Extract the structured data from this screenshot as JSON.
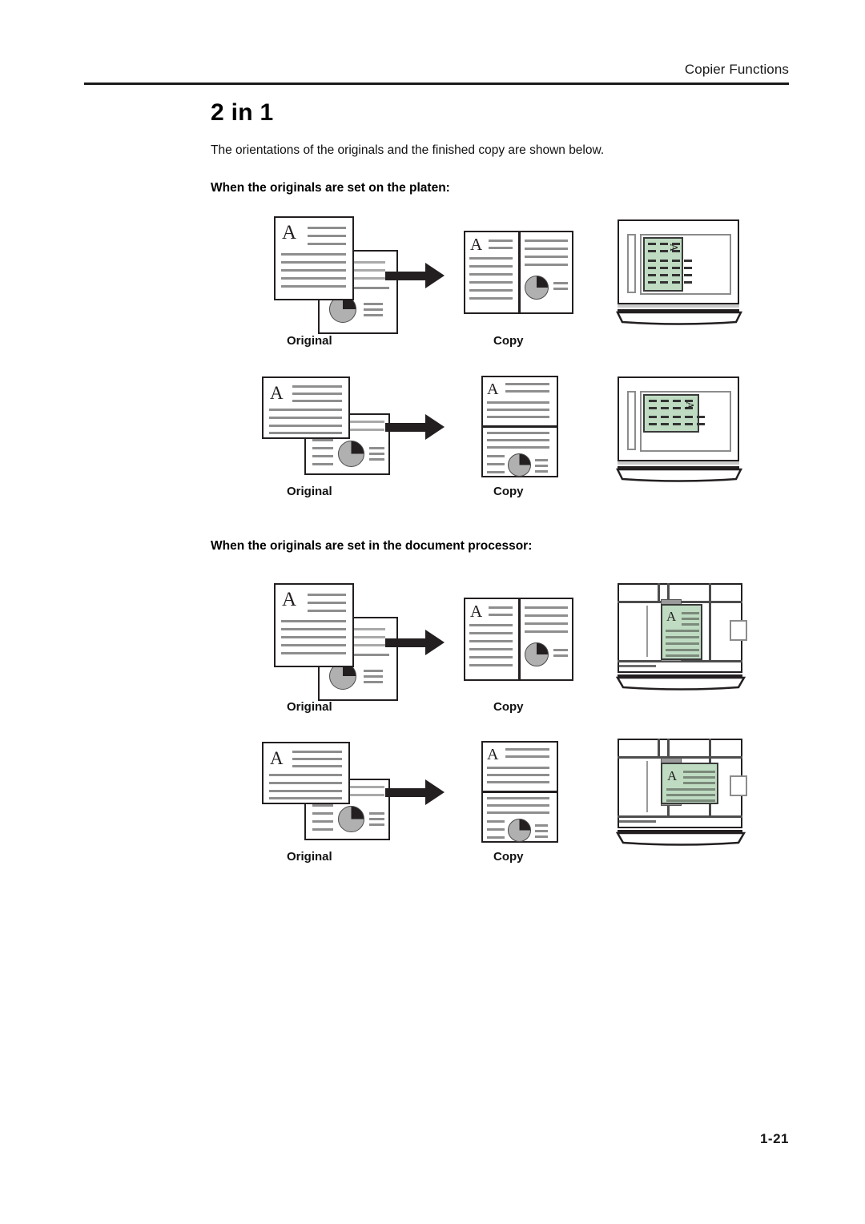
{
  "header": {
    "running_head": "Copier Functions"
  },
  "content": {
    "title": "2 in 1",
    "intro": "The orientations of the originals and the finished copy are shown below.",
    "subhead_platen": "When the originals are set on the platen:",
    "subhead_document_processor": "When the originals are set in the document processor:"
  },
  "labels": {
    "original": "Original",
    "copy": "Copy",
    "glyph_a": "A"
  },
  "figures": [
    {
      "id": "platen-portrait",
      "section": "platen",
      "original_orientation": "portrait",
      "copy_layout": "two-up-side-by-side",
      "machine": "platen-glass",
      "document_color": "#bfdcc2",
      "original_label": "Original",
      "copy_label": "Copy"
    },
    {
      "id": "platen-landscape",
      "section": "platen",
      "original_orientation": "landscape",
      "copy_layout": "two-up-stacked",
      "machine": "platen-glass",
      "document_color": "#bfdcc2",
      "original_label": "Original",
      "copy_label": "Copy"
    },
    {
      "id": "dp-portrait",
      "section": "document-processor",
      "original_orientation": "portrait",
      "copy_layout": "two-up-side-by-side",
      "machine": "document-processor",
      "document_color": "#bfdcc2",
      "original_label": "Original",
      "copy_label": "Copy"
    },
    {
      "id": "dp-landscape",
      "section": "document-processor",
      "original_orientation": "landscape",
      "copy_layout": "two-up-stacked",
      "machine": "document-processor",
      "document_color": "#bfdcc2",
      "original_label": "Original",
      "copy_label": "Copy"
    }
  ],
  "colors": {
    "ink": "#231f20",
    "rule_line": "#8e8e8e",
    "document_green": "#bfdcc2",
    "pie_dark": "#231f20",
    "pie_light": "#b0b0b0"
  },
  "footer": {
    "page_number": "1-21"
  }
}
